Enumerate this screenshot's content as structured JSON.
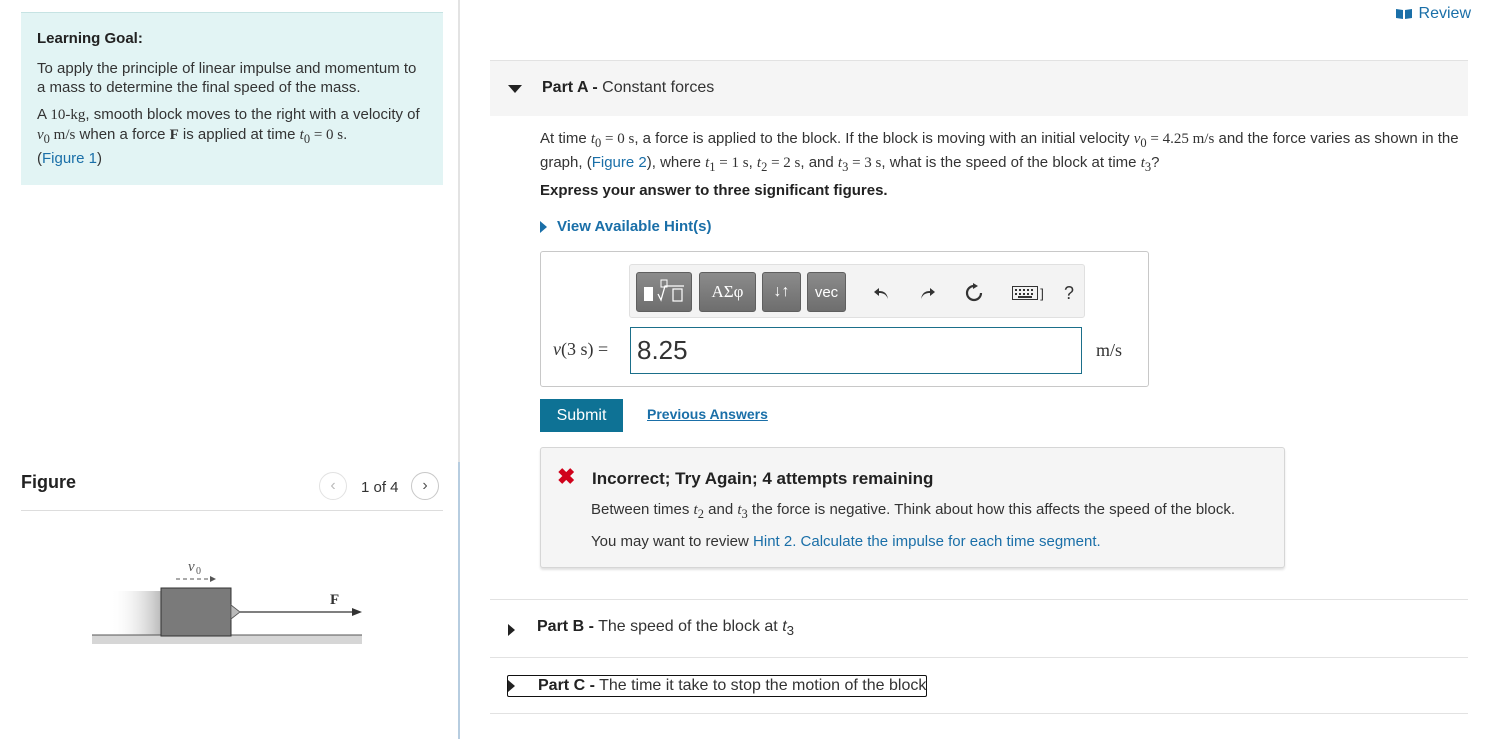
{
  "review": {
    "label": "Review"
  },
  "learning_goal": {
    "title": "Learning Goal:",
    "p1": "To apply the principle of linear impulse and momentum to a mass to determine the final speed of the mass.",
    "p2_a": "A ",
    "p2_mass": "10-kg",
    "p2_b": ", smooth block moves to the right with a velocity of ",
    "p2_v0": "v",
    "p2_v0_sub": "0",
    "p2_unit": " m/s",
    "p2_c": " when a force ",
    "p2_F": "F",
    "p2_d": " is applied at time ",
    "p2_t0": "t",
    "p2_t0_sub": "0",
    "p2_eq": " = 0 s",
    "p2_e": ".",
    "fig_link_open": "(",
    "fig_link": "Figure 1",
    "fig_link_close": ")"
  },
  "figure": {
    "title": "Figure",
    "counter": "1 of 4",
    "prev_icon": "chevron-left-icon",
    "next_icon": "chevron-right-icon",
    "v0_label": "v",
    "v0_sub": "0",
    "force_label": "F"
  },
  "part_a": {
    "letter": "Part A -",
    "title": " Constant forces",
    "q_a": "At time ",
    "q_t0": "t",
    "q_t0_sub": "0",
    "q_t0_eq": " = 0 s",
    "q_b": ", a force is applied to the block. If the block is moving with an initial velocity ",
    "q_v0": "v",
    "q_v0_sub": "0",
    "q_v0_eq": " = 4.25 m/s",
    "q_c": " and the force varies as shown in the graph, (",
    "q_fig": "Figure 2",
    "q_d": "), where ",
    "q_t1": "t",
    "q_t1_sub": "1",
    "q_t1_eq": " = 1 s",
    "q_e": ", ",
    "q_t2": "t",
    "q_t2_sub": "2",
    "q_t2_eq": " = 2 s",
    "q_f": ", and ",
    "q_t3": "t",
    "q_t3_sub": "3",
    "q_t3_eq": " = 3 s",
    "q_g": ", what is the speed of the block at time ",
    "q_t3b": "t",
    "q_t3b_sub": "3",
    "q_h": "?",
    "instruction": "Express your answer to three significant figures.",
    "hint_label": "View Available Hint(s)",
    "answer_label_v": "v",
    "answer_label_rest": "(3 s) =",
    "answer_value": "8.25",
    "answer_unit": "m/s",
    "toolbar": {
      "templates": "templates-icon",
      "greek": "ΑΣφ",
      "arrows": "↓↑",
      "vec": "vec",
      "undo": "undo-icon",
      "redo": "redo-icon",
      "reset": "reset-icon",
      "keyboard": "keyboard-icon",
      "keyboard_suffix": "]",
      "help": "?"
    },
    "submit": "Submit",
    "previous_answers": "Previous Answers",
    "feedback": {
      "title": "Incorrect; Try Again; 4 attempts remaining",
      "l1_a": "Between times ",
      "l1_t2": "t",
      "l1_t2_sub": "2",
      "l1_b": " and ",
      "l1_t3": "t",
      "l1_t3_sub": "3",
      "l1_c": " the force is negative. Think about how this affects the speed of the block.",
      "l2_a": "You may want to review ",
      "l2_link": "Hint 2. Calculate the impulse for each time segment",
      "l2_b": "."
    }
  },
  "part_b": {
    "letter": "Part B -",
    "title": " The speed of the block at ",
    "t": "t",
    "t_sub": "3"
  },
  "part_c": {
    "letter": "Part C -",
    "title": " The time it take to stop the motion of the block"
  },
  "colors": {
    "accent": "#0e7295",
    "link": "#1a6fa8",
    "goal_bg": "#e2f4f4",
    "error": "#d0021b"
  }
}
